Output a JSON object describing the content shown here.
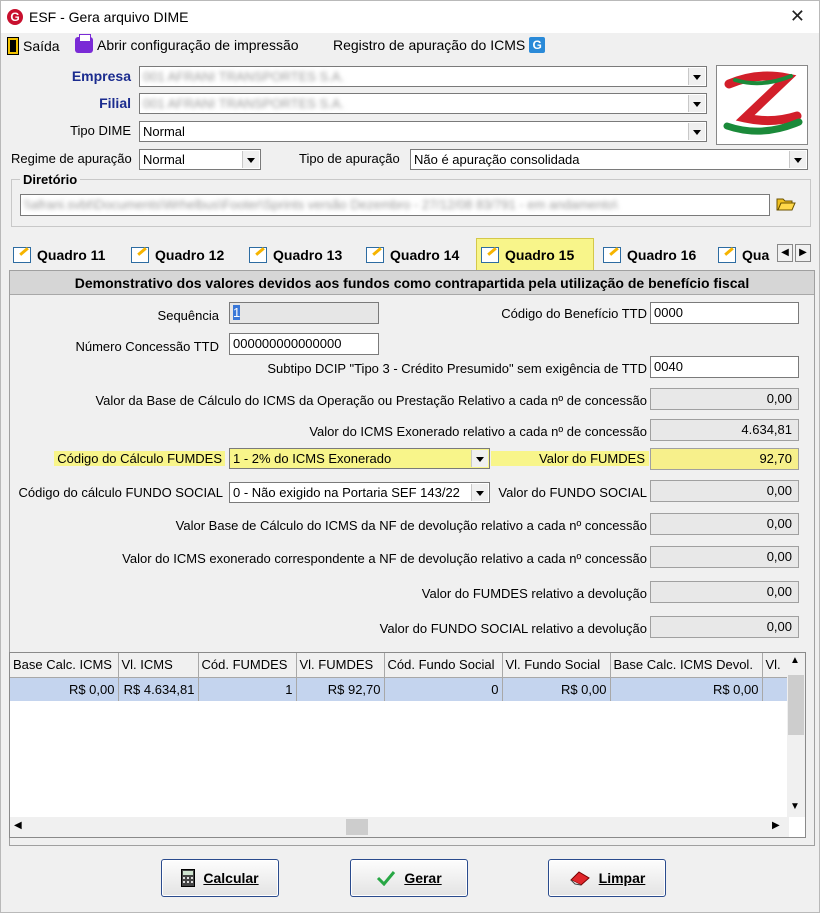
{
  "window": {
    "title": "ESF - Gera arquivo DIME",
    "close_glyph": "✕"
  },
  "toolbar": {
    "exit_label": "Saída",
    "print_config_label": "Abrir configuração de impressão",
    "icms_register_label": "Registro de apuração do ICMS"
  },
  "header": {
    "empresa_label": "Empresa",
    "empresa_value": "001 AFRANI TRANSPORTES S.A.",
    "filial_label": "Filial",
    "filial_value": "001 AFRANI TRANSPORTES S.A.",
    "tipo_dime_label": "Tipo DIME",
    "tipo_dime_value": "Normal",
    "regime_label": "Regime de apuração",
    "regime_value": "Normal",
    "tipo_apuracao_label": "Tipo de apuração",
    "tipo_apuracao_value": "Não é apuração consolidada",
    "diretorio_title": "Diretório",
    "diretorio_value": "\\\\afrani.svbt\\Documents\\Wrhelbus\\Footer\\Sprints versão Dezembro - 27/12/08 83/791 - em andamento\\"
  },
  "tabs": [
    {
      "label": "Quadro 11"
    },
    {
      "label": "Quadro 12"
    },
    {
      "label": "Quadro 13"
    },
    {
      "label": "Quadro 14"
    },
    {
      "label": "Quadro 15"
    },
    {
      "label": "Quadro 16"
    },
    {
      "label": "Qua"
    }
  ],
  "panel": {
    "heading": "Demonstrativo dos valores devidos aos fundos como contrapartida pela utilização de benefício fiscal",
    "sequencia_label": "Sequência",
    "sequencia_value": "1",
    "cod_beneficio_label": "Código do Benefício TTD",
    "cod_beneficio_value": "0000",
    "num_concessao_label": "Número Concessão TTD",
    "num_concessao_value": "000000000000000",
    "subtipo_label": "Subtipo DCIP \"Tipo 3 - Crédito Presumido\" sem exigência de TTD",
    "subtipo_value": "0040",
    "base_calc_label": "Valor da Base de Cálculo do ICMS da Operação ou Prestação Relativo a cada nº de concessão",
    "base_calc_value": "0,00",
    "icms_exonerado_label": "Valor do ICMS Exonerado relativo a cada nº de concessão",
    "icms_exonerado_value": "4.634,81",
    "cod_calc_fumdes_label": "Código do Cálculo FUMDES",
    "cod_calc_fumdes_value": "1 - 2% do ICMS Exonerado",
    "valor_fumdes_label": "Valor do FUMDES",
    "valor_fumdes_value": "92,70",
    "cod_calc_social_label": "Código do cálculo FUNDO SOCIAL",
    "cod_calc_social_value": "0 - Não exigido na Portaria SEF 143/22",
    "valor_social_label": "Valor do FUNDO SOCIAL",
    "valor_social_value": "0,00",
    "base_dev_label": "Valor Base de Cálculo do ICMS da NF de devolução relativo a cada nº concessão",
    "base_dev_value": "0,00",
    "icms_exo_dev_label": "Valor do ICMS exonerado correspondente a NF de devolução relativo a cada nº concessão",
    "icms_exo_dev_value": "0,00",
    "fumdes_dev_label": "Valor do FUMDES relativo a devolução",
    "fumdes_dev_value": "0,00",
    "social_dev_label": "Valor do FUNDO SOCIAL relativo a devolução",
    "social_dev_value": "0,00"
  },
  "grid": {
    "columns": [
      "Base Calc. ICMS",
      "Vl. ICMS",
      "Cód. FUMDES",
      "Vl. FUMDES",
      "Cód. Fundo Social",
      "Vl. Fundo Social",
      "Base Calc. ICMS Devol.",
      "Vl."
    ],
    "rows": [
      [
        "R$ 0,00",
        "R$ 4.634,81",
        "1",
        "R$ 92,70",
        "0",
        "R$ 0,00",
        "R$ 0,00",
        ""
      ]
    ]
  },
  "buttons": {
    "calcular_label": "Calcular",
    "gerar_label": "Gerar",
    "limpar_label": "Limpar"
  },
  "colors": {
    "highlight_yellow": "#f8f58a",
    "label_blue": "#1b2c8f",
    "selected_row": "#c4d4ee"
  }
}
